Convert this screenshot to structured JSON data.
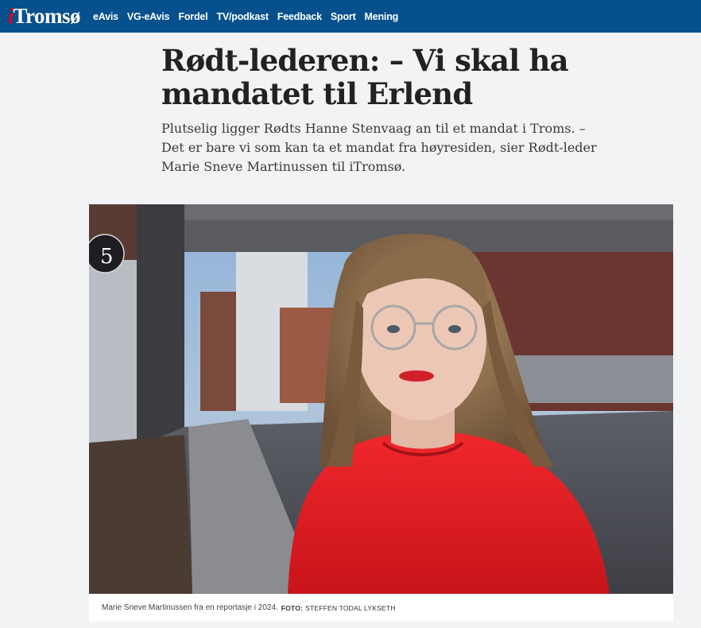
{
  "header": {
    "logo_i": "i",
    "logo_rest": "Tromsø",
    "nav": [
      "eAvis",
      "VG-eAvis",
      "Fordel",
      "TV/podkast",
      "Feedback",
      "Sport",
      "Mening"
    ]
  },
  "article": {
    "headline": "Rødt-lederen: – Vi skal ha mandatet til Erlend",
    "lead": "Plutselig ligger Rødts Hanne Stenvaag an til et mandat i Troms. – Det er bare vi som kan ta et mandat fra høyresiden, sier Rødt-leder Marie Sneve Martinussen til iTromsø.",
    "photo": {
      "sign_number": "5",
      "caption": "Marie Sneve Martinussen fra en reportasje i 2024.",
      "credit_label": "FOTO:",
      "credit": "STEFFEN TODAL LYKSETH"
    }
  },
  "colors": {
    "topbar": "#07508e",
    "logo_accent": "#e3001b"
  }
}
